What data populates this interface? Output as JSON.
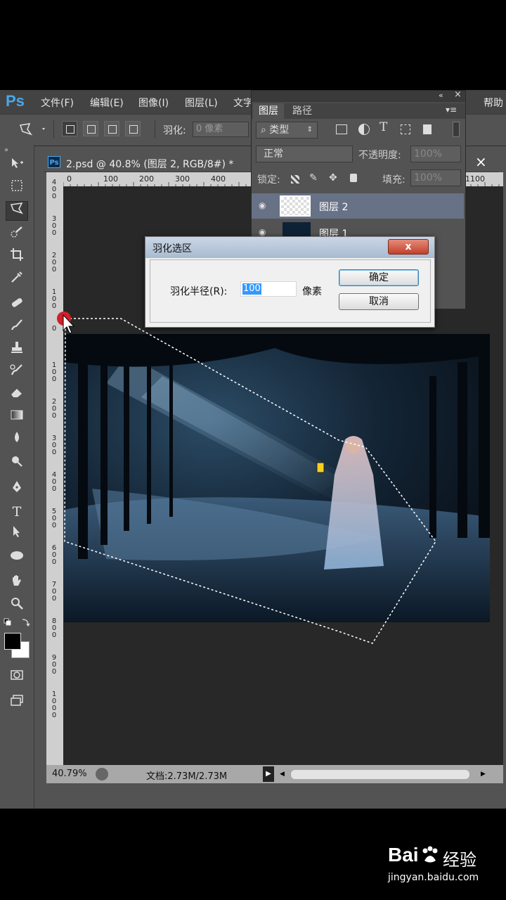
{
  "app": {
    "logo": "Ps",
    "menu": [
      "文件(F)",
      "编辑(E)",
      "图像(I)",
      "图层(L)",
      "文字",
      "帮助"
    ],
    "window_controls": [
      "»",
      "×"
    ]
  },
  "options_bar": {
    "feather_label": "羽化:",
    "feather_value": "0 像素"
  },
  "toolbar": {
    "tools": [
      "move-icon",
      "marquee-icon",
      "polygon-lasso-icon",
      "quick-select-icon",
      "crop-icon",
      "eyedropper-icon",
      "healing-icon",
      "brush-icon",
      "stamp-icon",
      "history-brush-icon",
      "eraser-icon",
      "gradient-icon",
      "blur-icon",
      "dodge-icon",
      "pen-icon",
      "type-icon",
      "path-select-icon",
      "ellipse-icon",
      "hand-icon",
      "zoom-icon"
    ],
    "type_glyph": "T",
    "expand": "»"
  },
  "document": {
    "badge": "Ps",
    "tab_title": "2.psd @ 40.8% (图层 2, RGB/8#) *",
    "close": "×",
    "ruler_top": [
      "0",
      "100",
      "200",
      "300",
      "400",
      "1100"
    ],
    "ruler_left": [
      "400",
      "300",
      "200",
      "100",
      "0",
      "100",
      "200",
      "300",
      "400",
      "500",
      "600",
      "700",
      "800",
      "900",
      "1000"
    ],
    "zoom": "40.79%",
    "doc_size": "文档:2.73M/2.73M"
  },
  "layers_panel": {
    "tabs": [
      "图层",
      "路径"
    ],
    "top_controls": [
      "«",
      "×"
    ],
    "filter_label": "类型",
    "filter_icons": [
      "T"
    ],
    "blend_mode": "正常",
    "opacity_label": "不透明度:",
    "opacity_value": "100%",
    "lock_label": "锁定:",
    "fill_label": "填充:",
    "fill_value": "100%",
    "layers": [
      {
        "name": "图层 2",
        "visible": true,
        "selected": true
      },
      {
        "name": "图层 1",
        "visible": true,
        "selected": false
      }
    ]
  },
  "dialog": {
    "title": "羽化选区",
    "close_glyph": "x",
    "radius_label": "羽化半径(R):",
    "radius_value": "100",
    "unit": "像素",
    "ok": "确定",
    "cancel": "取消"
  },
  "watermark": {
    "brand": "Bai",
    "brand2": "经验",
    "url": "jingyan.baidu.com"
  },
  "colors": {
    "ps_blue": "#4aa8e8",
    "panel": "#535353",
    "canvas_bg": "#282828",
    "selection_marker": "#d0202a"
  }
}
